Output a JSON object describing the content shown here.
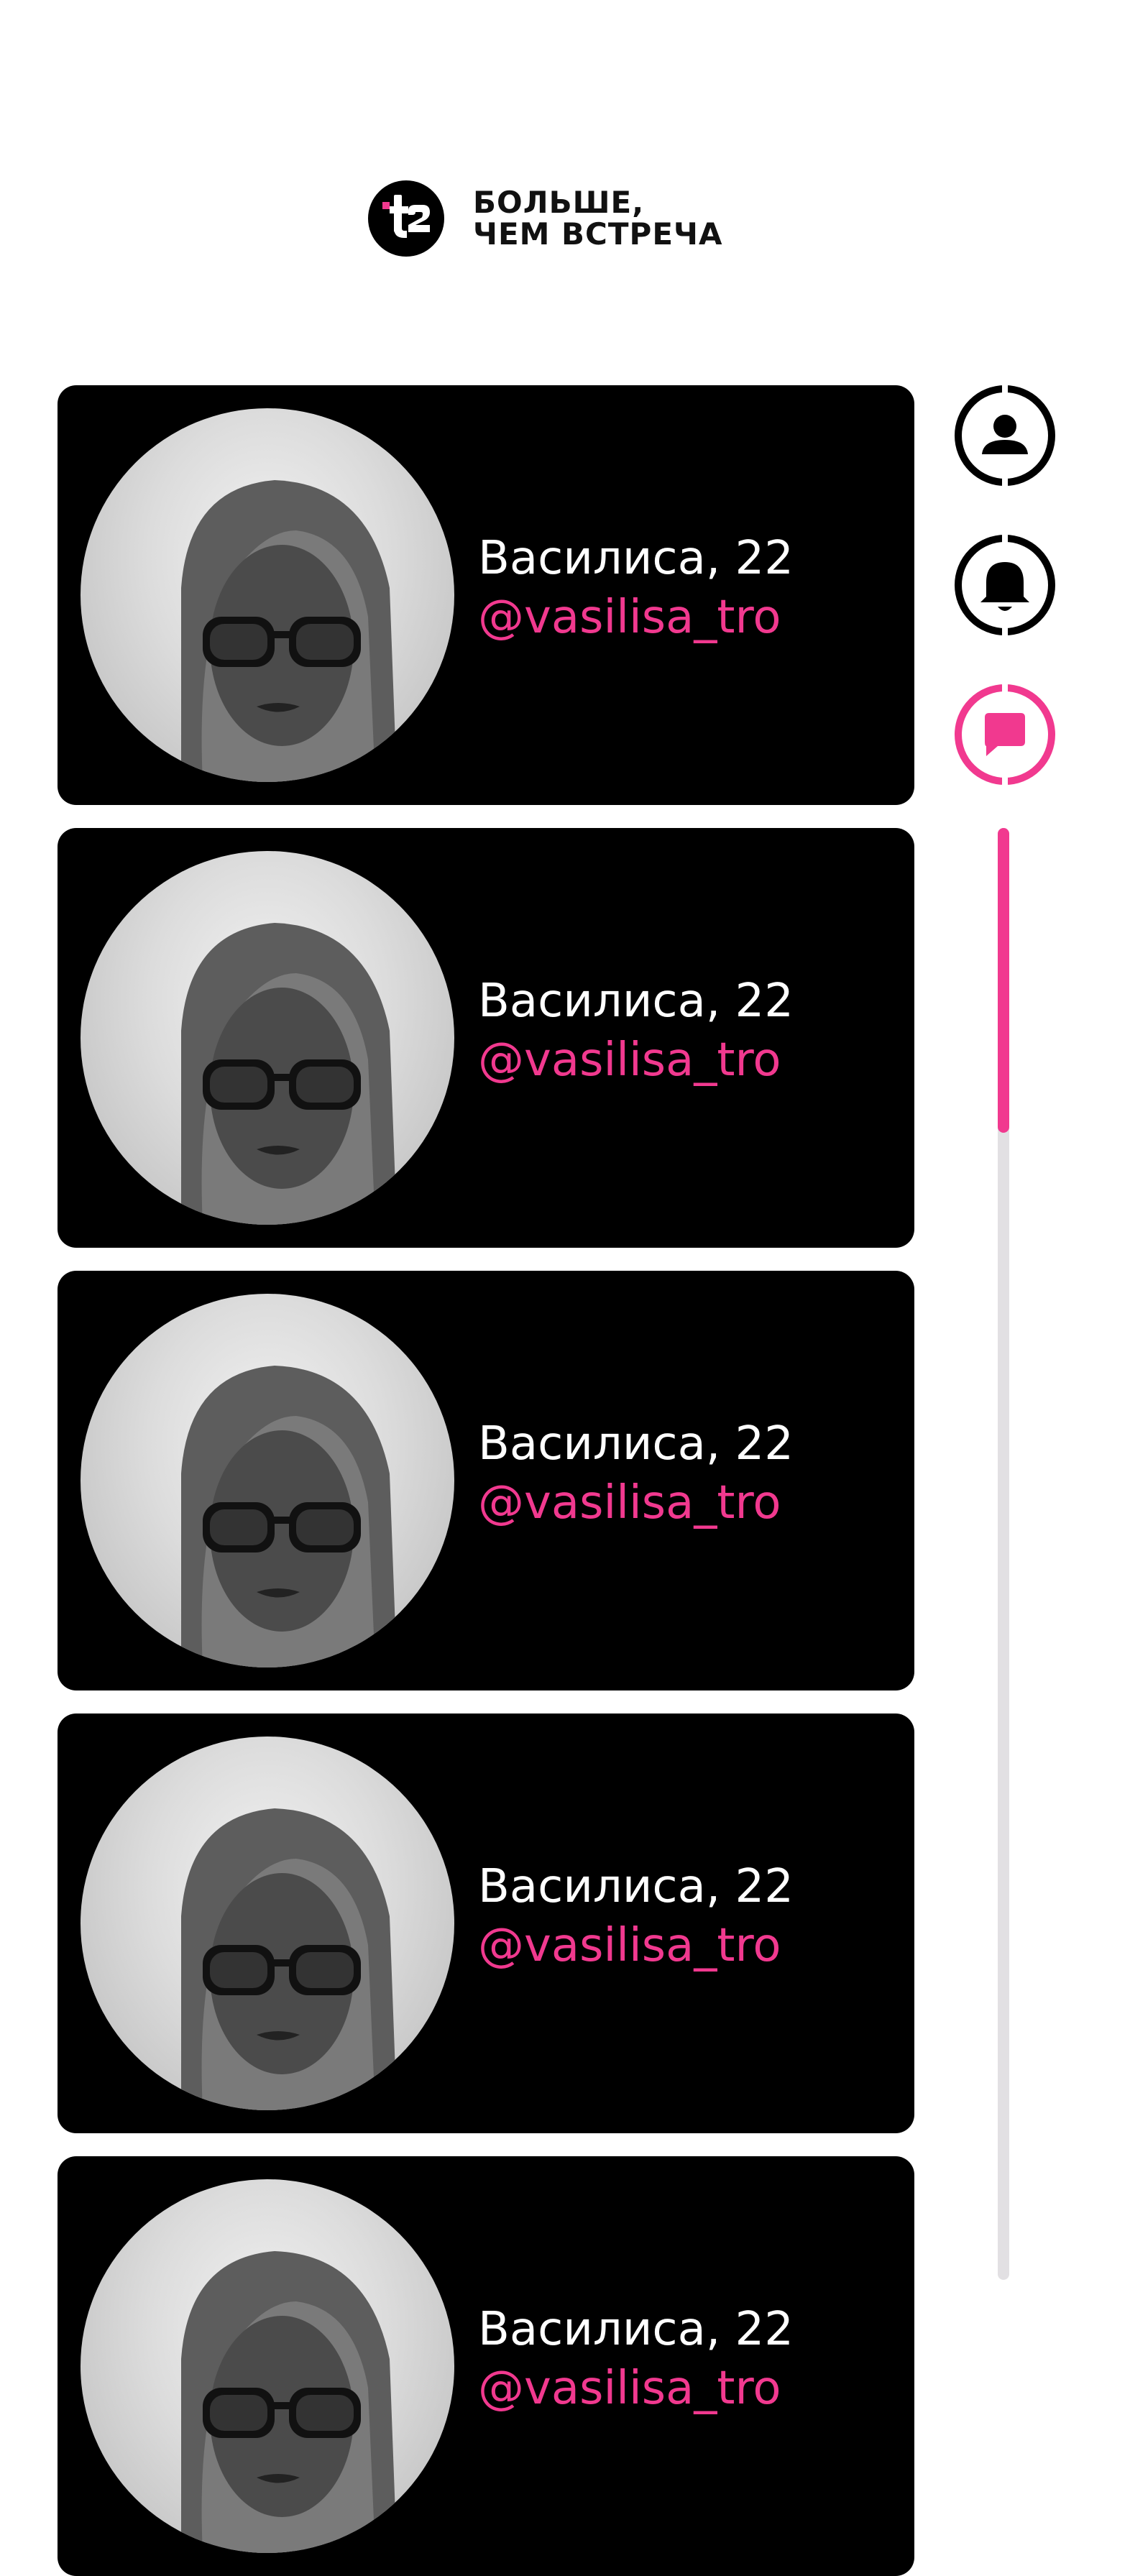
{
  "header": {
    "logo_alt": "t2",
    "slogan_line1": "БОЛЬШЕ,",
    "slogan_line2": "ЧЕМ ВСТРЕЧА"
  },
  "nav": {
    "items": [
      {
        "icon": "profile-icon",
        "active": false
      },
      {
        "icon": "bell-icon",
        "active": false
      },
      {
        "icon": "chat-icon",
        "active": true
      }
    ],
    "colors": {
      "inactive": "#000000",
      "active": "#f1398f"
    }
  },
  "scrollbar": {
    "position_fraction": 0.0,
    "visible_fraction": 0.21
  },
  "cards": [
    {
      "name": "Василиса, 22",
      "handle": "@vasilisa_tro"
    },
    {
      "name": "Василиса, 22",
      "handle": "@vasilisa_tro"
    },
    {
      "name": "Василиса, 22",
      "handle": "@vasilisa_tro"
    },
    {
      "name": "Василиса, 22",
      "handle": "@vasilisa_tro"
    },
    {
      "name": "Василиса, 22",
      "handle": "@vasilisa_tro"
    }
  ],
  "colors": {
    "accent": "#f1398f",
    "card_bg": "#000000",
    "page_bg": "#ffffff",
    "scroll_track": "#e2e0e3"
  }
}
